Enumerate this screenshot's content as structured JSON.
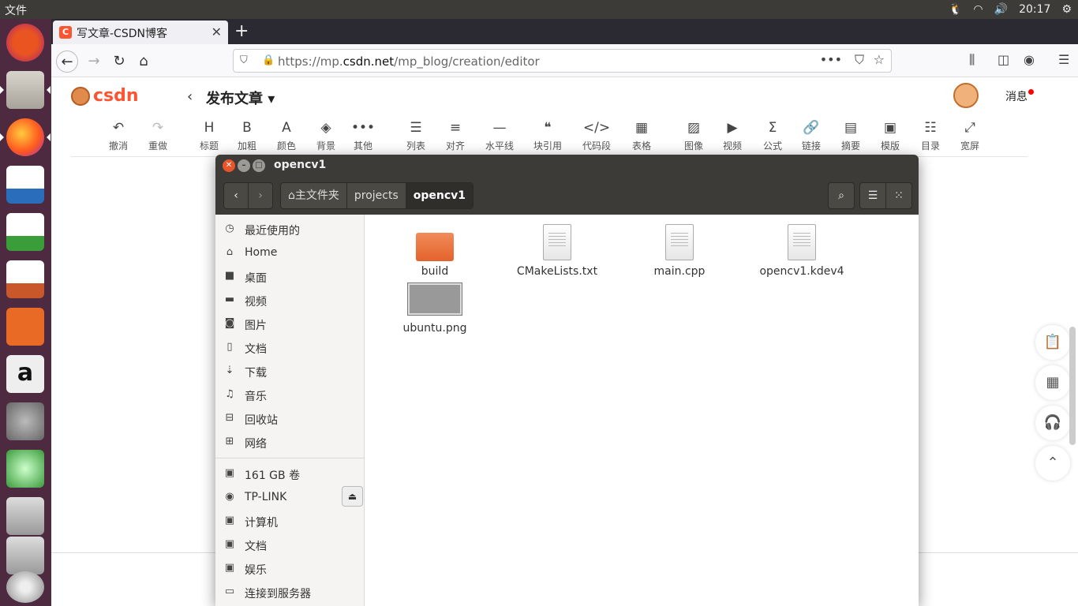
{
  "topbar": {
    "app_name": "文件",
    "clock": "20:17"
  },
  "launcher": {
    "items": [
      "ubuntu-dash",
      "files",
      "firefox",
      "libreoffice-writer",
      "libreoffice-calc",
      "libreoffice-impress",
      "software-center",
      "amazon",
      "system-settings",
      "kde-tool",
      "drive-1",
      "drive-2",
      "dvd"
    ]
  },
  "browser": {
    "tab_title": "写文章-CSDN博客",
    "tab_favicon": "C",
    "url_prefix": "https://mp.",
    "url_domain": "csdn.net",
    "url_path": "/mp_blog/creation/editor"
  },
  "csdn": {
    "logo_text": "CSDN",
    "page_title": "发布文章",
    "messages_label": "消息",
    "toolbar": [
      {
        "icon": "undo-icon",
        "glyph": "↶",
        "label": "撤消"
      },
      {
        "icon": "redo-icon",
        "glyph": "↷",
        "label": "重做"
      },
      {
        "icon": "heading-icon",
        "glyph": "H",
        "label": "标题"
      },
      {
        "icon": "bold-icon",
        "glyph": "B",
        "label": "加粗"
      },
      {
        "icon": "font-color-icon",
        "glyph": "A",
        "label": "颜色"
      },
      {
        "icon": "background-icon",
        "glyph": "◈",
        "label": "背景"
      },
      {
        "icon": "more-icon",
        "glyph": "•••",
        "label": "其他"
      },
      {
        "icon": "list-icon",
        "glyph": "☰",
        "label": "列表"
      },
      {
        "icon": "align-icon",
        "glyph": "≡",
        "label": "对齐"
      },
      {
        "icon": "hr-icon",
        "glyph": "—",
        "label": "水平线"
      },
      {
        "icon": "quote-icon",
        "glyph": "❝",
        "label": "块引用"
      },
      {
        "icon": "code-icon",
        "glyph": "</>",
        "label": "代码段"
      },
      {
        "icon": "table-icon",
        "glyph": "▦",
        "label": "表格"
      },
      {
        "icon": "image-icon",
        "glyph": "▨",
        "label": "图像"
      },
      {
        "icon": "video-icon",
        "glyph": "▶",
        "label": "视频"
      },
      {
        "icon": "formula-icon",
        "glyph": "Σ",
        "label": "公式"
      },
      {
        "icon": "link-icon",
        "glyph": "🔗",
        "label": "链接"
      },
      {
        "icon": "summary-icon",
        "glyph": "▤",
        "label": "摘要"
      },
      {
        "icon": "template-icon",
        "glyph": "▣",
        "label": "模版"
      },
      {
        "icon": "toc-icon",
        "glyph": "☷",
        "label": "目录"
      },
      {
        "icon": "widescreen-icon",
        "glyph": "⤢",
        "label": "宽屏"
      }
    ]
  },
  "nautilus": {
    "window_title": "opencv1",
    "breadcrumbs": [
      "主文件夹",
      "projects",
      "opencv1"
    ],
    "sidebar_places": [
      {
        "icon": "recent-icon",
        "glyph": "◷",
        "label": "最近使用的"
      },
      {
        "icon": "home-icon",
        "glyph": "⌂",
        "label": "Home"
      },
      {
        "icon": "desktop-folder-icon",
        "glyph": "■",
        "label": "桌面"
      },
      {
        "icon": "videos-icon",
        "glyph": "▬",
        "label": "视频"
      },
      {
        "icon": "pictures-icon",
        "glyph": "◙",
        "label": "图片"
      },
      {
        "icon": "documents-icon",
        "glyph": "▯",
        "label": "文档"
      },
      {
        "icon": "downloads-icon",
        "glyph": "⇣",
        "label": "下载"
      },
      {
        "icon": "music-icon",
        "glyph": "♫",
        "label": "音乐"
      },
      {
        "icon": "trash-icon",
        "glyph": "⊟",
        "label": "回收站"
      },
      {
        "icon": "network-icon",
        "glyph": "⊞",
        "label": "网络"
      }
    ],
    "sidebar_devices": [
      {
        "icon": "drive-icon",
        "glyph": "▣",
        "label": "161 GB 卷"
      },
      {
        "icon": "network-drive-icon",
        "glyph": "◉",
        "label": "TP-LINK"
      },
      {
        "icon": "drive-icon",
        "glyph": "▣",
        "label": "计算机"
      },
      {
        "icon": "drive-icon",
        "glyph": "▣",
        "label": "文档"
      },
      {
        "icon": "drive-icon",
        "glyph": "▣",
        "label": "娱乐"
      },
      {
        "icon": "connect-server-icon",
        "glyph": "▭",
        "label": "连接到服务器"
      }
    ],
    "files": [
      {
        "name": "build",
        "kind": "folder"
      },
      {
        "name": "CMakeLists.txt",
        "kind": "text"
      },
      {
        "name": "main.cpp",
        "kind": "cpp"
      },
      {
        "name": "opencv1.kdev4",
        "kind": "text"
      },
      {
        "name": "ubuntu.png",
        "kind": "image"
      }
    ]
  },
  "colors": {
    "accent": "#fc5531",
    "launcher_bg": "#4d2a3f",
    "panel_bg": "#3c3b37",
    "folder": "#e4622b"
  }
}
